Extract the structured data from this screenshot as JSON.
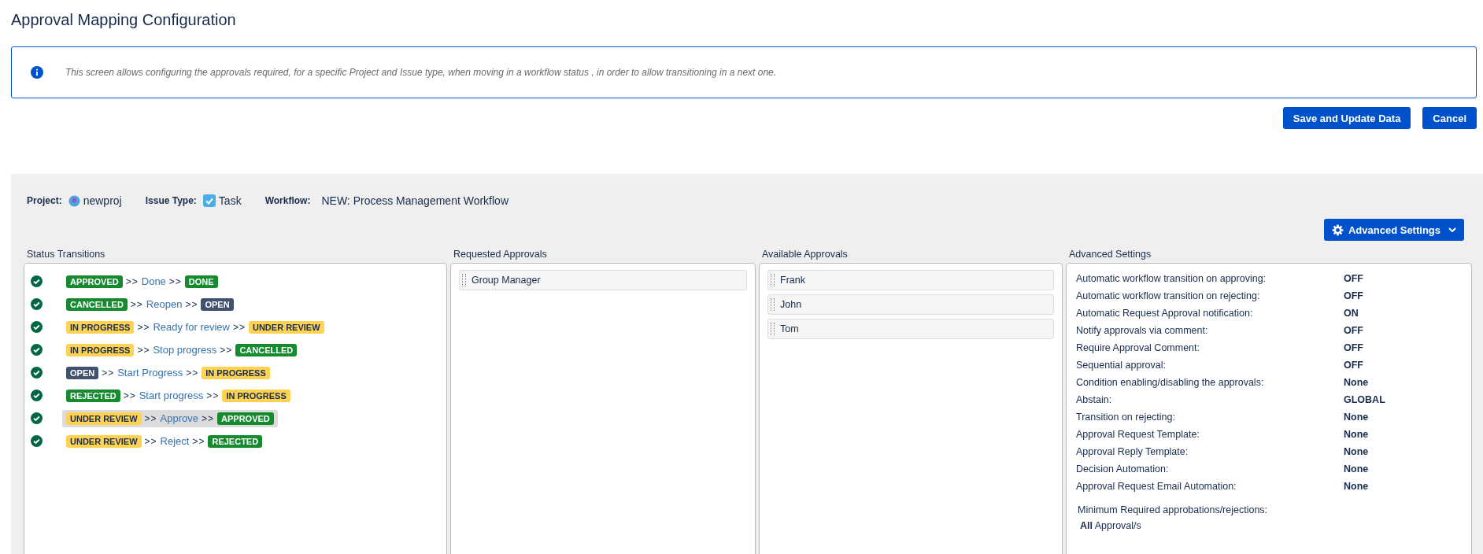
{
  "title": "Approval Mapping Configuration",
  "info": "This screen allows configuring the approvals required, for a specific Project and Issue type, when moving in a workflow status , in order to allow transitioning in a next one.",
  "buttons": [
    {
      "label": "Save and Update Data"
    },
    {
      "label": "Cancel"
    }
  ],
  "context": {
    "project_label": "Project:",
    "project": "newproj",
    "issue_type_label": "Issue Type:",
    "issue_type": "Task",
    "workflow_label": "Workflow:",
    "workflow": "NEW: Process Management Workflow"
  },
  "advanced_button": "Advanced Settings",
  "status_transitions": {
    "heading": "Status Transitions",
    "rows": [
      {
        "from": {
          "label": "APPROVED",
          "kind": "success"
        },
        "arrow1": ">>",
        "transition": "Done",
        "arrow2": ">>",
        "to": {
          "label": "DONE",
          "kind": "success"
        },
        "selected": false
      },
      {
        "from": {
          "label": "CANCELLED",
          "kind": "success"
        },
        "arrow1": ">>",
        "transition": "Reopen",
        "arrow2": ">>",
        "to": {
          "label": "OPEN",
          "kind": "default"
        },
        "selected": false
      },
      {
        "from": {
          "label": "IN PROGRESS",
          "kind": "current"
        },
        "arrow1": ">>",
        "transition": "Ready for review",
        "arrow2": ">>",
        "to": {
          "label": "UNDER REVIEW",
          "kind": "current"
        },
        "selected": false
      },
      {
        "from": {
          "label": "IN PROGRESS",
          "kind": "current"
        },
        "arrow1": ">>",
        "transition": "Stop progress",
        "arrow2": ">>",
        "to": {
          "label": "CANCELLED",
          "kind": "success"
        },
        "selected": false
      },
      {
        "from": {
          "label": "OPEN",
          "kind": "default"
        },
        "arrow1": ">>",
        "transition": "Start Progress",
        "arrow2": ">>",
        "to": {
          "label": "IN PROGRESS",
          "kind": "current"
        },
        "selected": false
      },
      {
        "from": {
          "label": "REJECTED",
          "kind": "success"
        },
        "arrow1": ">>",
        "transition": "Start progress",
        "arrow2": ">>",
        "to": {
          "label": "IN PROGRESS",
          "kind": "current"
        },
        "selected": false
      },
      {
        "from": {
          "label": "UNDER REVIEW",
          "kind": "current"
        },
        "arrow1": ">>",
        "transition": "Approve",
        "arrow2": ">>",
        "to": {
          "label": "APPROVED",
          "kind": "success"
        },
        "selected": true
      },
      {
        "from": {
          "label": "UNDER REVIEW",
          "kind": "current"
        },
        "arrow1": ">>",
        "transition": "Reject",
        "arrow2": ">>",
        "to": {
          "label": "REJECTED",
          "kind": "success"
        },
        "selected": false
      }
    ]
  },
  "requested_approvals": {
    "heading": "Requested Approvals",
    "items": [
      "Group Manager"
    ]
  },
  "available_approvals": {
    "heading": "Available Approvals",
    "items": [
      "Frank",
      "John",
      "Tom"
    ]
  },
  "advanced_settings": {
    "heading": "Advanced Settings",
    "rows": [
      {
        "label": "Automatic workflow transition on approving:",
        "value": "OFF"
      },
      {
        "label": "Automatic workflow transition on rejecting:",
        "value": "OFF"
      },
      {
        "label": "Automatic Request Approval notification:",
        "value": "ON"
      },
      {
        "label": "Notify approvals via comment:",
        "value": "OFF"
      },
      {
        "label": "Require Approval Comment:",
        "value": "OFF"
      },
      {
        "label": "Sequential approval:",
        "value": "OFF"
      },
      {
        "label": "Condition enabling/disabling the approvals:",
        "value": "None"
      },
      {
        "label": "Abstain:",
        "value": "GLOBAL"
      },
      {
        "label": "Transition on rejecting:",
        "value": "None"
      },
      {
        "label": "Approval Request Template:",
        "value": "None"
      },
      {
        "label": "Approval Reply Template:",
        "value": "None"
      },
      {
        "label": "Decision Automation:",
        "value": "None"
      },
      {
        "label": "Approval Request Email Automation:",
        "value": "None"
      }
    ],
    "minimum_label": "Minimum Required approbations/rejections:",
    "minimum_value": "**All** Approval/s"
  }
}
